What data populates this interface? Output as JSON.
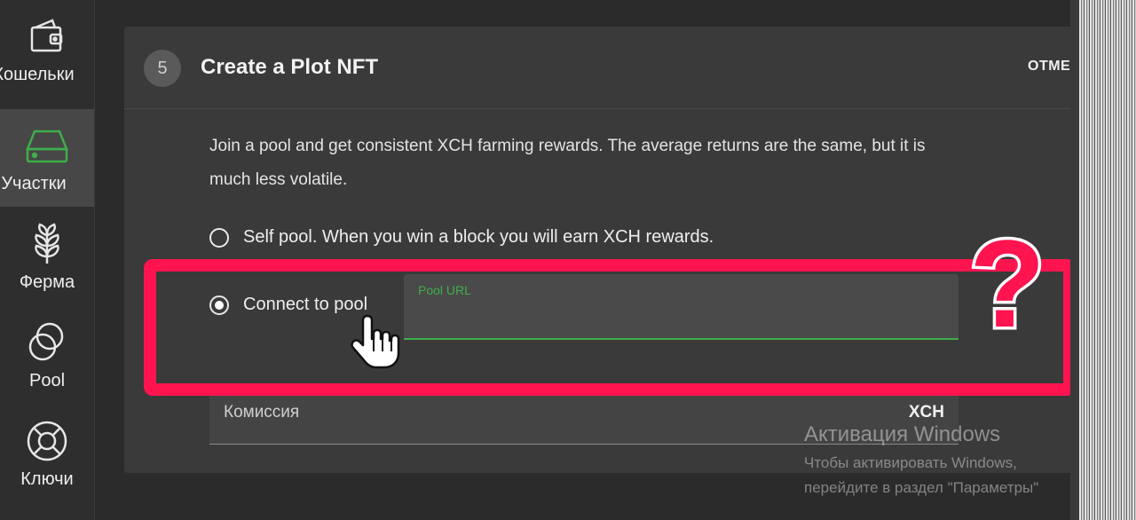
{
  "sidebar": {
    "items": [
      {
        "label": "Кошельки",
        "icon": "wallet-icon",
        "active": false
      },
      {
        "label": "Участки",
        "icon": "plot-drive-icon",
        "active": true
      },
      {
        "label": "Ферма",
        "icon": "plant-icon",
        "active": false
      },
      {
        "label": "Pool",
        "icon": "pool-circles-icon",
        "active": false
      },
      {
        "label": "Ключи",
        "icon": "lifebuoy-icon",
        "active": false
      }
    ]
  },
  "card": {
    "step_number": "5",
    "title": "Create a Plot NFT",
    "cancel_label": "ОТМЕН",
    "description": "Join a pool and get consistent XCH farming rewards. The average returns are the same, but it is much less volatile.",
    "options": [
      {
        "label": "Self pool. When you win a block you will earn XCH rewards.",
        "selected": false
      },
      {
        "label": "Connect to pool",
        "selected": true
      }
    ],
    "pool_url_label": "Pool URL",
    "fee_label": "Комиссия",
    "fee_unit": "XCH"
  },
  "annotation": {
    "symbol": "?",
    "color": "#ff1450"
  },
  "watermark": {
    "title": "Активация Windows",
    "line1": "Чтобы активировать Windows,",
    "line2": "перейдите в раздел \"Параметры\""
  },
  "colors": {
    "accent_green": "#3fae4a",
    "highlight": "#ff1450"
  }
}
